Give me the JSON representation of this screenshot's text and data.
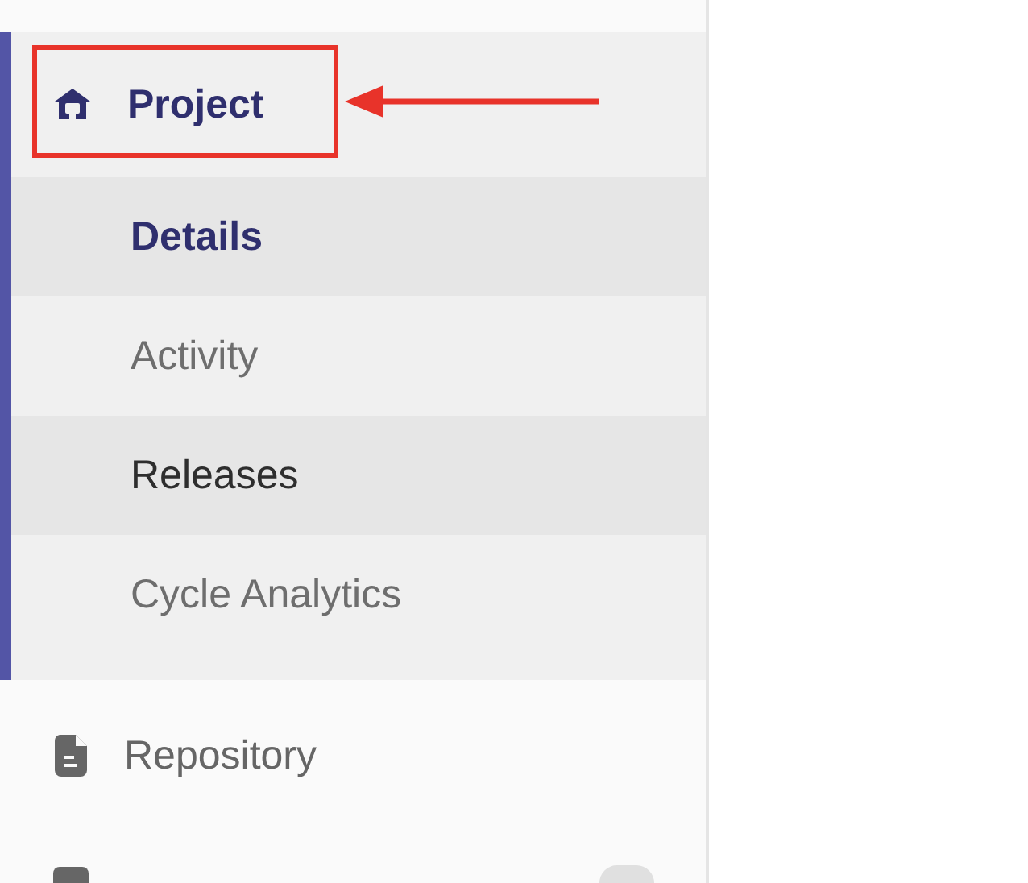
{
  "sidebar": {
    "section": {
      "label": "Project",
      "expanded": true,
      "children": [
        {
          "label": "Details",
          "selected": true,
          "hovered": false
        },
        {
          "label": "Activity",
          "selected": false,
          "hovered": false
        },
        {
          "label": "Releases",
          "selected": false,
          "hovered": true
        },
        {
          "label": "Cycle Analytics",
          "selected": false,
          "hovered": false
        }
      ]
    },
    "items": [
      {
        "kind": "document",
        "label": "Repository"
      },
      {
        "kind": "partial"
      }
    ]
  },
  "annotation": {
    "kind": "box-arrow"
  }
}
